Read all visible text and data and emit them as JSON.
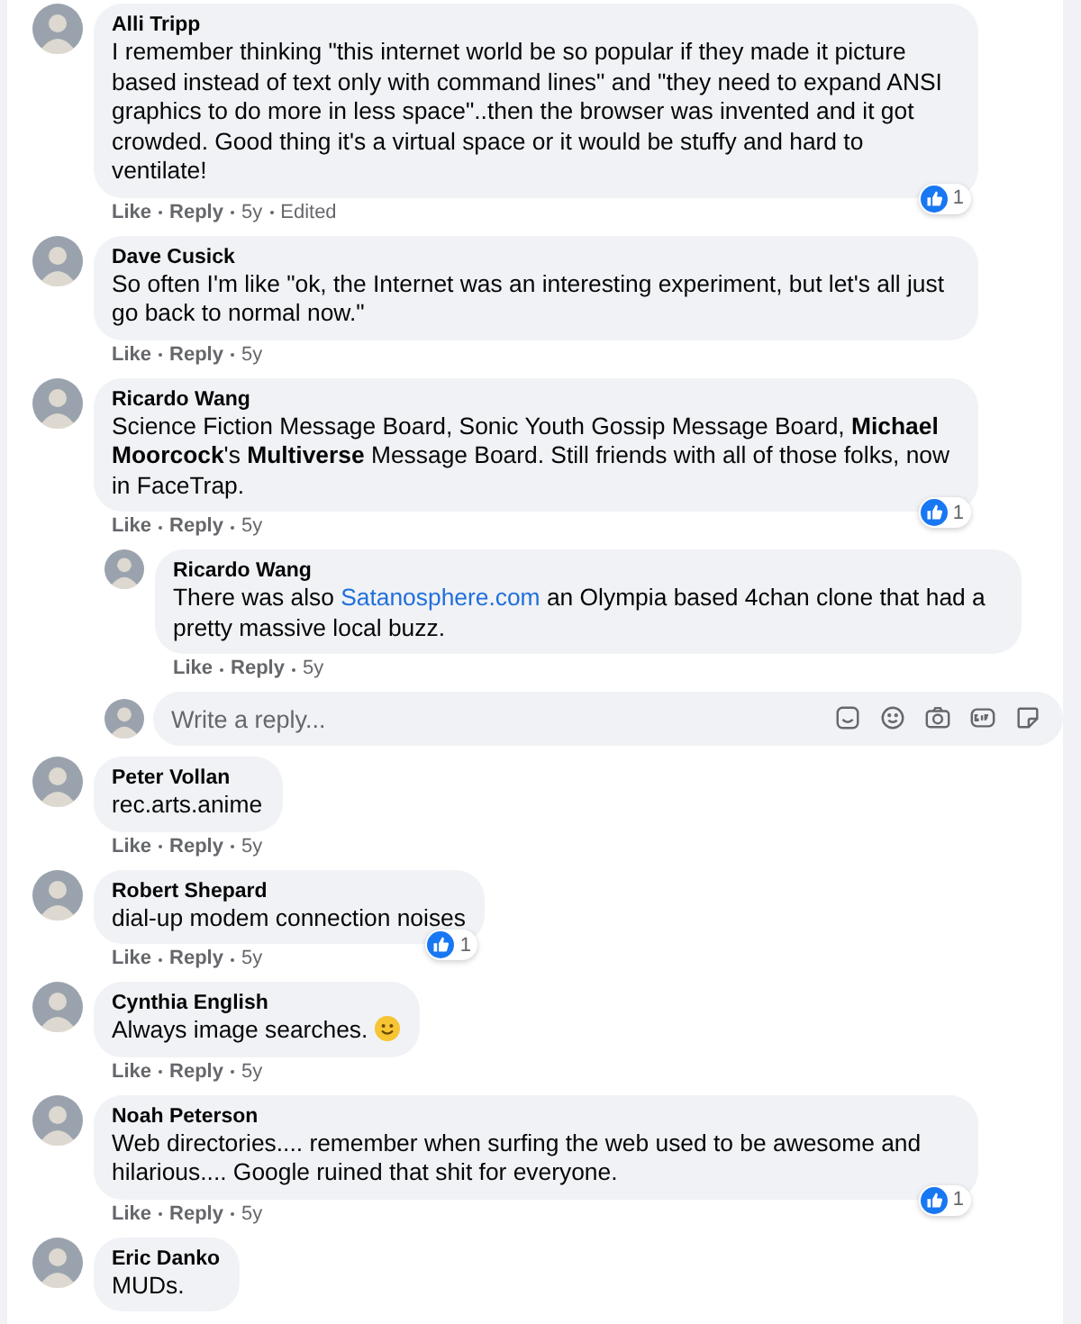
{
  "comments": [
    {
      "author": "Alli Tripp",
      "text": [
        {
          "kind": "text",
          "text": "I remember thinking \"this internet world be so popular if they made it picture based instead of text only with command lines\" and \"they need to expand ANSI graphics to do more in less space\"..then the browser was invented and it got crowded. Good thing it's a virtual space or it would be stuffy and hard to ventilate!"
        }
      ],
      "actions": [
        "Like",
        "Reply"
      ],
      "time": "5y",
      "edited": "Edited",
      "reactions": "1"
    },
    {
      "author": "Dave Cusick",
      "text": [
        {
          "kind": "text",
          "text": "So often I'm like \"ok, the Internet was an interesting experiment, but let's all just go back to normal now.\""
        }
      ],
      "actions": [
        "Like",
        "Reply"
      ],
      "time": "5y"
    },
    {
      "author": "Ricardo Wang",
      "text": [
        {
          "kind": "text",
          "text": "Science Fiction Message Board, Sonic Youth Gossip Message Board, **Michael Moorcock**'s **Multiverse** Message Board. Still friends with all of those folks, now in FaceTrap."
        }
      ],
      "actions": [
        "Like",
        "Reply"
      ],
      "time": "5y",
      "reactions": "1",
      "replies": [
        {
          "author": "Ricardo Wang",
          "text": [
            {
              "kind": "text",
              "text": "There was also "
            },
            {
              "kind": "link",
              "text": "Satanosphere.com"
            },
            {
              "kind": "text",
              "text": " an Olympia based 4chan clone that had a pretty massive local buzz."
            }
          ],
          "actions": [
            "Like",
            "Reply"
          ],
          "time": "5y"
        }
      ],
      "reply_box": {
        "placeholder": "Write a reply..."
      }
    },
    {
      "author": "Peter Vollan",
      "text": [
        {
          "kind": "text",
          "text": "rec.arts.anime"
        }
      ],
      "actions": [
        "Like",
        "Reply"
      ],
      "time": "5y"
    },
    {
      "author": "Robert Shepard",
      "text": [
        {
          "kind": "text",
          "text": "dial-up modem connection noises"
        }
      ],
      "actions": [
        "Like",
        "Reply"
      ],
      "time": "5y",
      "reactions": "1"
    },
    {
      "author": "Cynthia English",
      "text": [
        {
          "kind": "text",
          "text": "Always image searches. "
        },
        {
          "kind": "emoji"
        }
      ],
      "actions": [
        "Like",
        "Reply"
      ],
      "time": "5y"
    },
    {
      "author": "Noah Peterson",
      "text": [
        {
          "kind": "text",
          "text": "Web directories.... remember when surfing the web used to be awesome and hilarious.... Google ruined that shit for everyone."
        }
      ],
      "actions": [
        "Like",
        "Reply"
      ],
      "time": "5y",
      "reactions": "1"
    },
    {
      "author": "Eric Danko",
      "text": [
        {
          "kind": "text",
          "text": "MUDs."
        }
      ]
    }
  ]
}
